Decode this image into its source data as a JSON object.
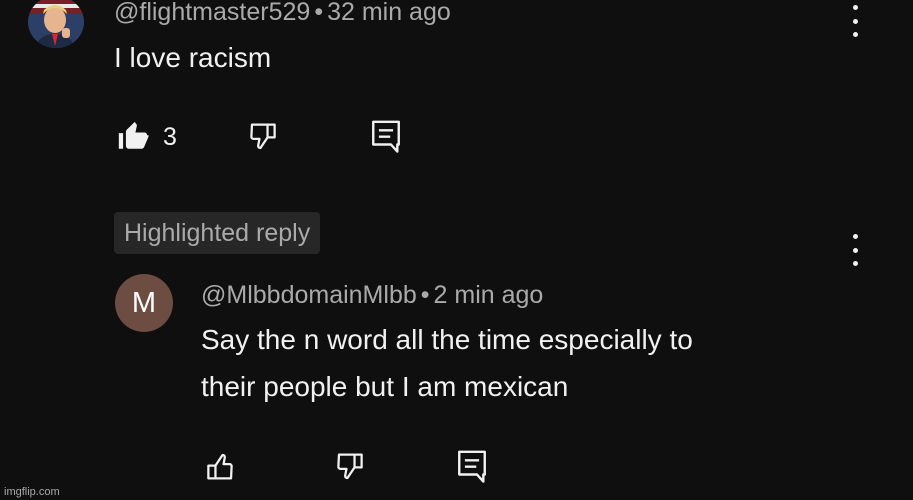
{
  "comment": {
    "handle": "@flightmaster529",
    "separator": "•",
    "time": "32 min ago",
    "text": "I love racism",
    "like_count": "3",
    "like_icon": "thumbs-up-filled-icon",
    "dislike_icon": "thumbs-down-outline-icon",
    "reply_icon": "reply-comment-icon",
    "menu_icon": "more-vert-icon"
  },
  "reply": {
    "badge": "Highlighted reply",
    "avatar_letter": "M",
    "avatar_color": "#6d4c41",
    "handle": "@MlbbdomainMlbb",
    "separator": "•",
    "time": "2 min ago",
    "text_line1": "Say the n word all the time especially to",
    "text_line2": "their people but I am mexican",
    "like_icon": "thumbs-up-outline-icon",
    "dislike_icon": "thumbs-down-outline-icon",
    "reply_icon": "reply-comment-icon",
    "menu_icon": "more-vert-icon"
  },
  "watermark": "imgflip.com",
  "colors": {
    "background": "#0f0f0f",
    "text": "#f1f1f1",
    "muted": "#aaaaaa",
    "badge_bg": "#272727"
  }
}
